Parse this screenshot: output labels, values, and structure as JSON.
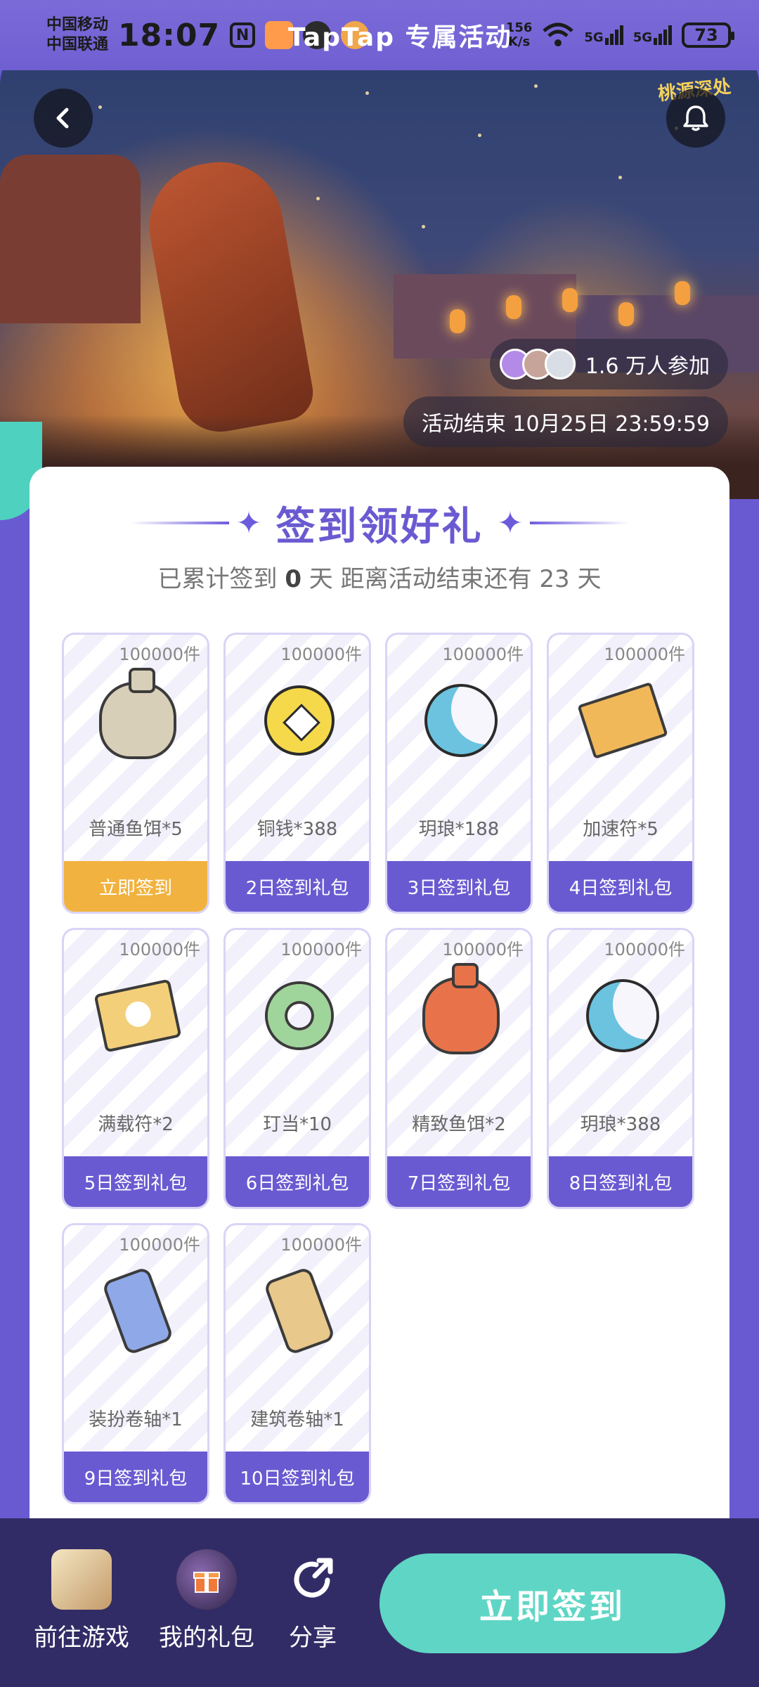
{
  "status_bar": {
    "carrier_1": "中国移动",
    "carrier_2": "中国联通",
    "time": "18:07",
    "net_speed_value": "156",
    "net_speed_unit": "K/s",
    "signal_1": "5G",
    "signal_2": "5G",
    "battery": "73"
  },
  "header": {
    "title": "TapTap 专属活动",
    "brand_text": "桃源深处"
  },
  "hero": {
    "participants": "1.6 万人参加",
    "deadline": "活动结束 10月25日 23:59:59"
  },
  "signin": {
    "title": "签到领好礼",
    "progress_prefix": "已累计签到",
    "signed_days": "0",
    "progress_mid": "天  距离活动结束还有",
    "remaining_days": "23",
    "progress_suffix": "天",
    "gifts": [
      {
        "count": "100000件",
        "name": "普通鱼饵*5",
        "button": "立即签到",
        "icon": "bait-bag-icon"
      },
      {
        "count": "100000件",
        "name": "铜钱*388",
        "button": "2日签到礼包",
        "icon": "copper-coin-icon"
      },
      {
        "count": "100000件",
        "name": "玥琅*188",
        "button": "3日签到礼包",
        "icon": "crescent-moon-icon"
      },
      {
        "count": "100000件",
        "name": "加速符*5",
        "button": "4日签到礼包",
        "icon": "speed-talisman-icon"
      },
      {
        "count": "100000件",
        "name": "满载符*2",
        "button": "5日签到礼包",
        "icon": "full-load-talisman-icon"
      },
      {
        "count": "100000件",
        "name": "玎当*10",
        "button": "6日签到礼包",
        "icon": "jade-ring-icon"
      },
      {
        "count": "100000件",
        "name": "精致鱼饵*2",
        "button": "7日签到礼包",
        "icon": "fine-bait-bag-icon"
      },
      {
        "count": "100000件",
        "name": "玥琅*388",
        "button": "8日签到礼包",
        "icon": "crescent-moon-icon"
      },
      {
        "count": "100000件",
        "name": "装扮卷轴*1",
        "button": "9日签到礼包",
        "icon": "outfit-scroll-icon"
      },
      {
        "count": "100000件",
        "name": "建筑卷轴*1",
        "button": "10日签到礼包",
        "icon": "building-scroll-icon"
      }
    ]
  },
  "bottom_bar": {
    "go_game": "前往游戏",
    "my_gifts": "我的礼包",
    "share": "分享",
    "sign_in_cta": "立即签到"
  },
  "colors": {
    "primary": "#6a5ad1",
    "active_button": "#f1b23f",
    "cta": "#5fd6c5",
    "bottom_bar": "#322c66"
  }
}
